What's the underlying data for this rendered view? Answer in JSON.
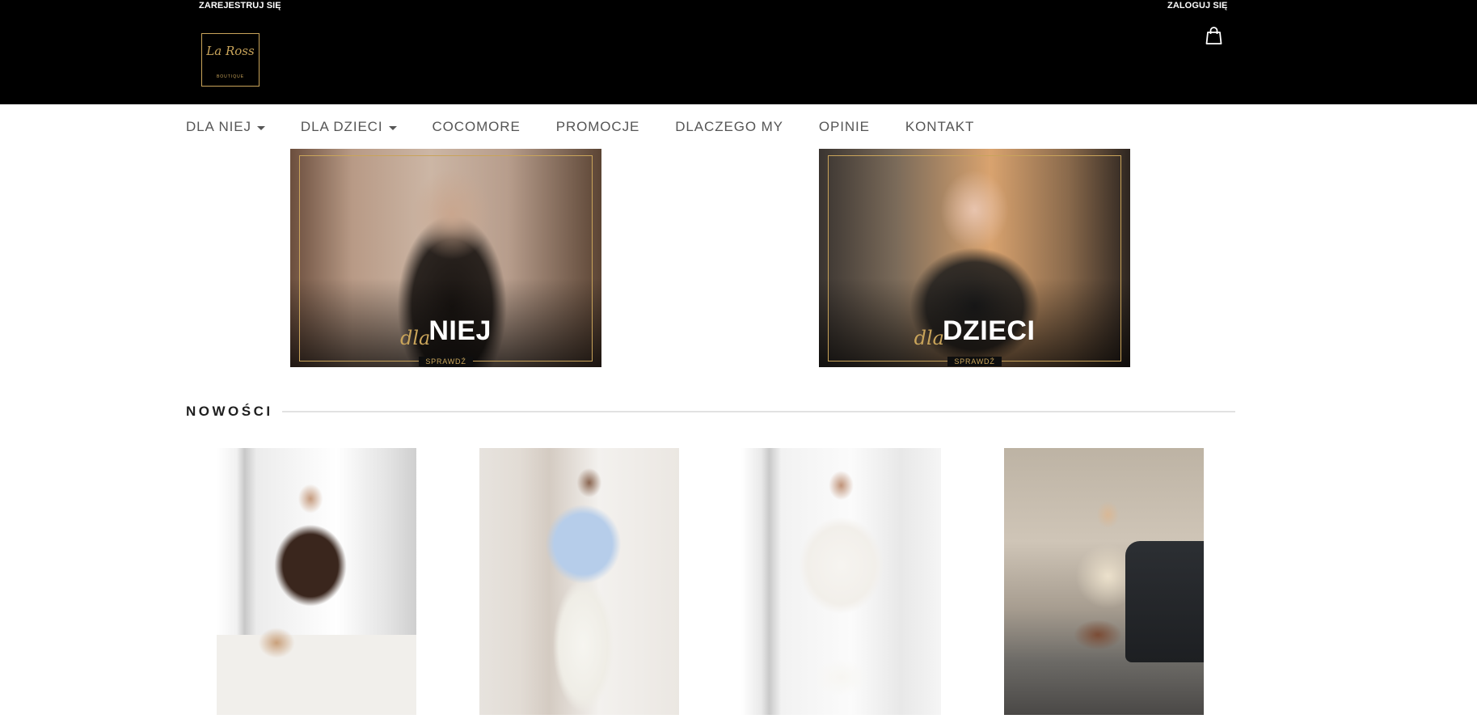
{
  "header": {
    "register_label": "ZAREJESTRUJ SIĘ",
    "login_label": "ZALOGUJ SIĘ",
    "logo": {
      "script_text": "La Ross",
      "sub_text": "BOUTIQUE"
    },
    "cart_icon": "shopping-bag-icon",
    "background_color": "#000000",
    "accent_color": "#c9a45a"
  },
  "nav": {
    "items": [
      {
        "label": "DLA NIEJ",
        "dropdown": true
      },
      {
        "label": "DLA DZIECI",
        "dropdown": true
      },
      {
        "label": "COCOMORE",
        "dropdown": false
      },
      {
        "label": "PROMOCJE",
        "dropdown": false
      },
      {
        "label": "DLACZEGO MY",
        "dropdown": false
      },
      {
        "label": "OPINIE",
        "dropdown": false
      },
      {
        "label": "KONTAKT",
        "dropdown": false
      }
    ]
  },
  "banners": [
    {
      "script": "dla",
      "word": "NIEJ",
      "cta": "SPRAWDŹ"
    },
    {
      "script": "dla",
      "word": "DZIECI",
      "cta": "SPRAWDŹ"
    }
  ],
  "new_section": {
    "title": "NOWOŚCI",
    "products": [
      {
        "image": "woman in brown blouse and white trousers"
      },
      {
        "image": "woman in light blue blouse and white trousers"
      },
      {
        "image": "woman in white ruffle blouse and white shorts"
      },
      {
        "image": "woman in cream lace blouse and brown shorts"
      }
    ]
  }
}
